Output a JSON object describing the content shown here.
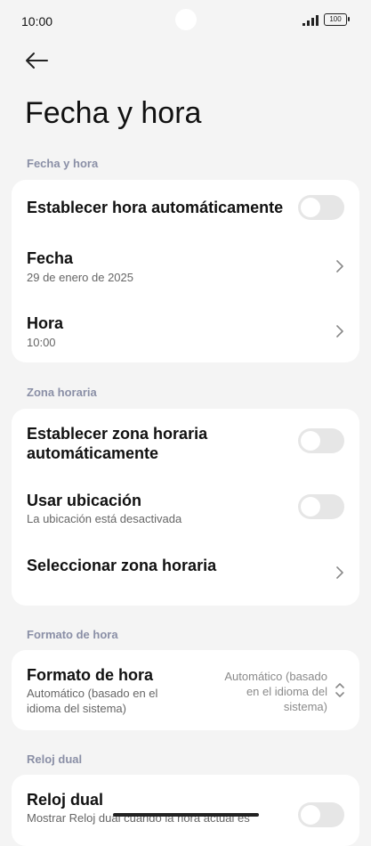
{
  "status": {
    "time": "10:00",
    "battery": "100"
  },
  "header": {
    "title": "Fecha y hora"
  },
  "sections": {
    "date_time": {
      "label": "Fecha y hora",
      "auto_time": {
        "title": "Establecer hora automáticamente",
        "enabled": false
      },
      "date": {
        "title": "Fecha",
        "value": "29 de enero de 2025"
      },
      "time": {
        "title": "Hora",
        "value": "10:00"
      }
    },
    "timezone": {
      "label": "Zona horaria",
      "auto_timezone": {
        "title_line1": "Establecer zona horaria",
        "title_line2": "automáticamente",
        "enabled": false
      },
      "use_location": {
        "title": "Usar ubicación",
        "subtitle": "La ubicación está desactivada",
        "enabled": false
      },
      "select_timezone": {
        "title": "Seleccionar zona horaria"
      }
    },
    "time_format": {
      "label": "Formato de hora",
      "format": {
        "title": "Formato de hora",
        "subtitle_line1": "Automático (basado en el",
        "subtitle_line2": "idioma del sistema)",
        "value_line1": "Automático (basado",
        "value_line2": "en el idioma del",
        "value_line3": "sistema)"
      }
    },
    "dual_clock": {
      "label": "Reloj dual",
      "dual": {
        "title": "Reloj dual",
        "subtitle": "Mostrar Reloj dual cuando la hora actual es",
        "enabled": false
      }
    }
  }
}
